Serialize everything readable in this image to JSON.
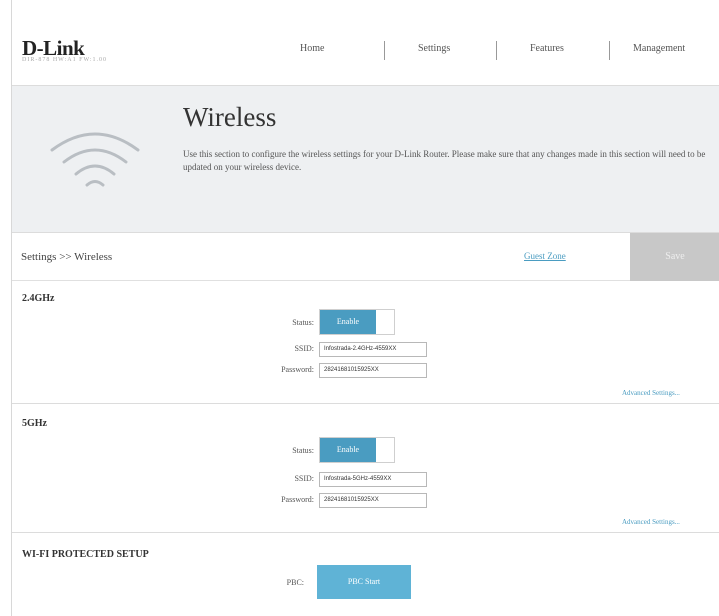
{
  "brand": {
    "name": "D-Link",
    "tagline": "DIR-878 HW:A1 FW:1.00"
  },
  "nav": {
    "items": [
      {
        "label": "Home"
      },
      {
        "label": "Settings"
      },
      {
        "label": "Features"
      },
      {
        "label": "Management"
      }
    ]
  },
  "hero": {
    "title": "Wireless",
    "description": "Use this section to configure the wireless settings for your D-Link Router. Please make sure that any changes made in this section will need to be updated on your wireless device."
  },
  "breadcrumb": {
    "text": "Settings >> Wireless"
  },
  "toolbar": {
    "quick_link": "Guest Zone",
    "save_label": "Save"
  },
  "labels": {
    "status": "Status:",
    "ssid": "SSID:",
    "password": "Password:",
    "pbc": "PBC:"
  },
  "band_24": {
    "title": "2.4GHz",
    "status": "Enable",
    "ssid": "Infostrada-2.4GHz-4559XX",
    "password": "28241681015925XX",
    "advanced": "Advanced Settings..."
  },
  "band_5": {
    "title": "5GHz",
    "status": "Enable",
    "ssid": "Infostrada-5GHz-4559XX",
    "password": "28241681015925XX",
    "advanced": "Advanced Settings..."
  },
  "wps": {
    "title": "WI-FI PROTECTED SETUP",
    "button": "PBC Start"
  },
  "colors": {
    "accent": "#4a9cc1",
    "save_disabled": "#c8c8c8",
    "hero_bg": "#eef0f2"
  }
}
